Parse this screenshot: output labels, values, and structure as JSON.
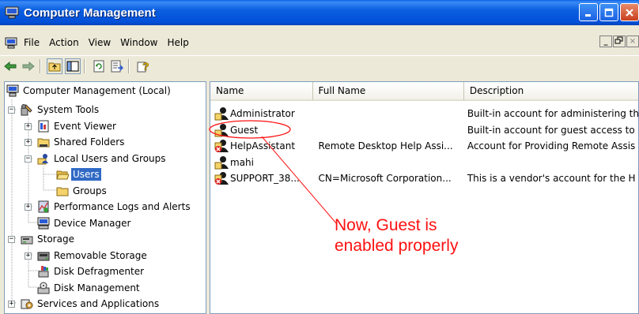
{
  "window": {
    "title": "Computer Management"
  },
  "menubar": {
    "items": [
      "File",
      "Action",
      "View",
      "Window",
      "Help"
    ]
  },
  "toolbar": {
    "buttons": [
      "back-arrow-icon",
      "forward-arrow-icon",
      "up-folder-icon",
      "show-hide-tree-icon",
      "refresh-icon",
      "export-list-icon",
      "help-icon"
    ]
  },
  "tree": {
    "items": [
      {
        "label": "Computer Management (Local)",
        "icon": "computer-management-icon"
      },
      {
        "label": "System Tools",
        "icon": "tools-icon",
        "expander": "−"
      },
      {
        "label": "Event Viewer",
        "icon": "event-viewer-icon",
        "expander": "+"
      },
      {
        "label": "Shared Folders",
        "icon": "folder-icon",
        "expander": "+"
      },
      {
        "label": "Local Users and Groups",
        "icon": "users-groups-icon",
        "expander": "−"
      },
      {
        "label": "Users",
        "icon": "folder-open-icon",
        "selected": true
      },
      {
        "label": "Groups",
        "icon": "folder-icon"
      },
      {
        "label": "Performance Logs and Alerts",
        "icon": "performance-icon",
        "expander": "+"
      },
      {
        "label": "Device Manager",
        "icon": "device-manager-icon"
      },
      {
        "label": "Storage",
        "icon": "storage-icon",
        "expander": "−"
      },
      {
        "label": "Removable Storage",
        "icon": "removable-storage-icon",
        "expander": "+"
      },
      {
        "label": "Disk Defragmenter",
        "icon": "defragmenter-icon"
      },
      {
        "label": "Disk Management",
        "icon": "disk-management-icon"
      },
      {
        "label": "Services and Applications",
        "icon": "services-icon",
        "expander": "+"
      }
    ]
  },
  "list": {
    "columns": [
      "Name",
      "Full Name",
      "Description"
    ],
    "rows": [
      {
        "name": "Administrator",
        "full_name": "",
        "description": "Built-in account for administering th",
        "disabled": false
      },
      {
        "name": "Guest",
        "full_name": "",
        "description": "Built-in account for guest access to",
        "disabled": false
      },
      {
        "name": "HelpAssistant",
        "full_name": "Remote Desktop Help Assi...",
        "description": "Account for Providing Remote Assis",
        "disabled": true
      },
      {
        "name": "mahi",
        "full_name": "",
        "description": "",
        "disabled": false
      },
      {
        "name": "SUPPORT_38...",
        "full_name": "CN=Microsoft Corporation...",
        "description": "This is a vendor's account for the H",
        "disabled": true
      }
    ]
  },
  "annotation": {
    "line1": "Now, Guest is",
    "line2": "enabled properly",
    "color": "#ff1010"
  },
  "colors": {
    "titlebar": "#0350d8",
    "selection": "#316ac5",
    "window_face": "#ece9d8"
  }
}
